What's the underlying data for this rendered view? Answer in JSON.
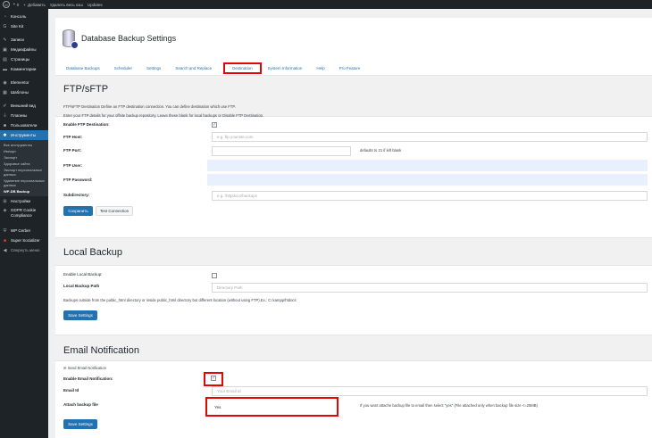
{
  "adminbar": {
    "comments_count": "0",
    "add_new": "Добавить",
    "clear_cache": "Удалить весь кэш",
    "updates": "Updates"
  },
  "sidebar": {
    "items": [
      {
        "label": "Консоль",
        "icon": "dashboard-icon"
      },
      {
        "label": "Site Kit",
        "icon": "sitekit-icon"
      },
      {
        "label": "Записи",
        "icon": "pin-icon"
      },
      {
        "label": "Медиафайлы",
        "icon": "media-icon"
      },
      {
        "label": "Страницы",
        "icon": "page-icon"
      },
      {
        "label": "Комментарии",
        "icon": "comment-icon"
      },
      {
        "label": "Elementor",
        "icon": "elementor-icon"
      },
      {
        "label": "Шаблоны",
        "icon": "template-icon"
      },
      {
        "label": "Внешний вид",
        "icon": "brush-icon"
      },
      {
        "label": "Плагины",
        "icon": "plugin-icon"
      },
      {
        "label": "Пользователи",
        "icon": "user-icon"
      },
      {
        "label": "Инструменты",
        "icon": "wrench-icon"
      }
    ],
    "submenu": [
      "Все инструменты",
      "Импорт",
      "Экспорт",
      "Здоровье сайта",
      "Экспорт персональных данных",
      "Удаление персональных данных",
      "WP-DB Backup"
    ],
    "items_after": [
      {
        "label": "Настройки",
        "icon": "settings-icon"
      },
      {
        "label": "GDPR Cookie Compliance",
        "icon": "gdpr-icon"
      },
      {
        "label": "WP Cerber",
        "icon": "cerber-icon"
      },
      {
        "label": "Super Socializer",
        "icon": "socializer-icon"
      },
      {
        "label": "Свернуть меню",
        "icon": "collapse-icon"
      }
    ]
  },
  "header": {
    "title": "Database Backup Settings"
  },
  "tabs": [
    "Database Backups",
    "Scheduler",
    "Settings",
    "Search and Replace",
    "Destination",
    "System Information",
    "Help",
    "Pro Feature"
  ],
  "ftp": {
    "title": "FTP/sFTP",
    "desc1": "FTP/sFTP Destination Define an FTP destination connection. You can define destination which use FTP.",
    "desc2": "Enter your FTP details for your offsite backup repository. Leave these blank for local backups or Disable FTP Destination.",
    "enable_label": "Enable FTP Destination:",
    "host_label": "FTP Host:",
    "host_placeholder": "e.g. ftp.yoursite.com",
    "port_label": "FTP Port:",
    "port_hint": "defaults to 21 if left blank",
    "user_label": "FTP User:",
    "password_label": "FTP Password:",
    "subdir_label": "Subdirectory:",
    "subdir_placeholder": "e.g. /httpdocs/backups",
    "save": "Сохранить",
    "test": "Test Connection"
  },
  "local": {
    "title": "Local Backup",
    "enable_label": "Enable Local Backup:",
    "path_label": "Local Backup Path",
    "path_placeholder": "Directory Path",
    "note": "Backups outside from the public_html directory or inside public_html directory but different location (without using FTP).Ex.: C:/xampp/htdocs",
    "save": "Save Settings"
  },
  "email": {
    "title": "Email Notification",
    "send_label": "Send Email Notification",
    "enable_label": "Enable Email Notification:",
    "email_label": "Email Id",
    "email_placeholder": "Your Email Id",
    "attach_label": "Attach backup file",
    "attach_value": "Yes",
    "attach_hint": "If you want attache backup file to email then select \"yes\" (File attached only when backup file size <=25MB)",
    "save": "Save Settings"
  }
}
